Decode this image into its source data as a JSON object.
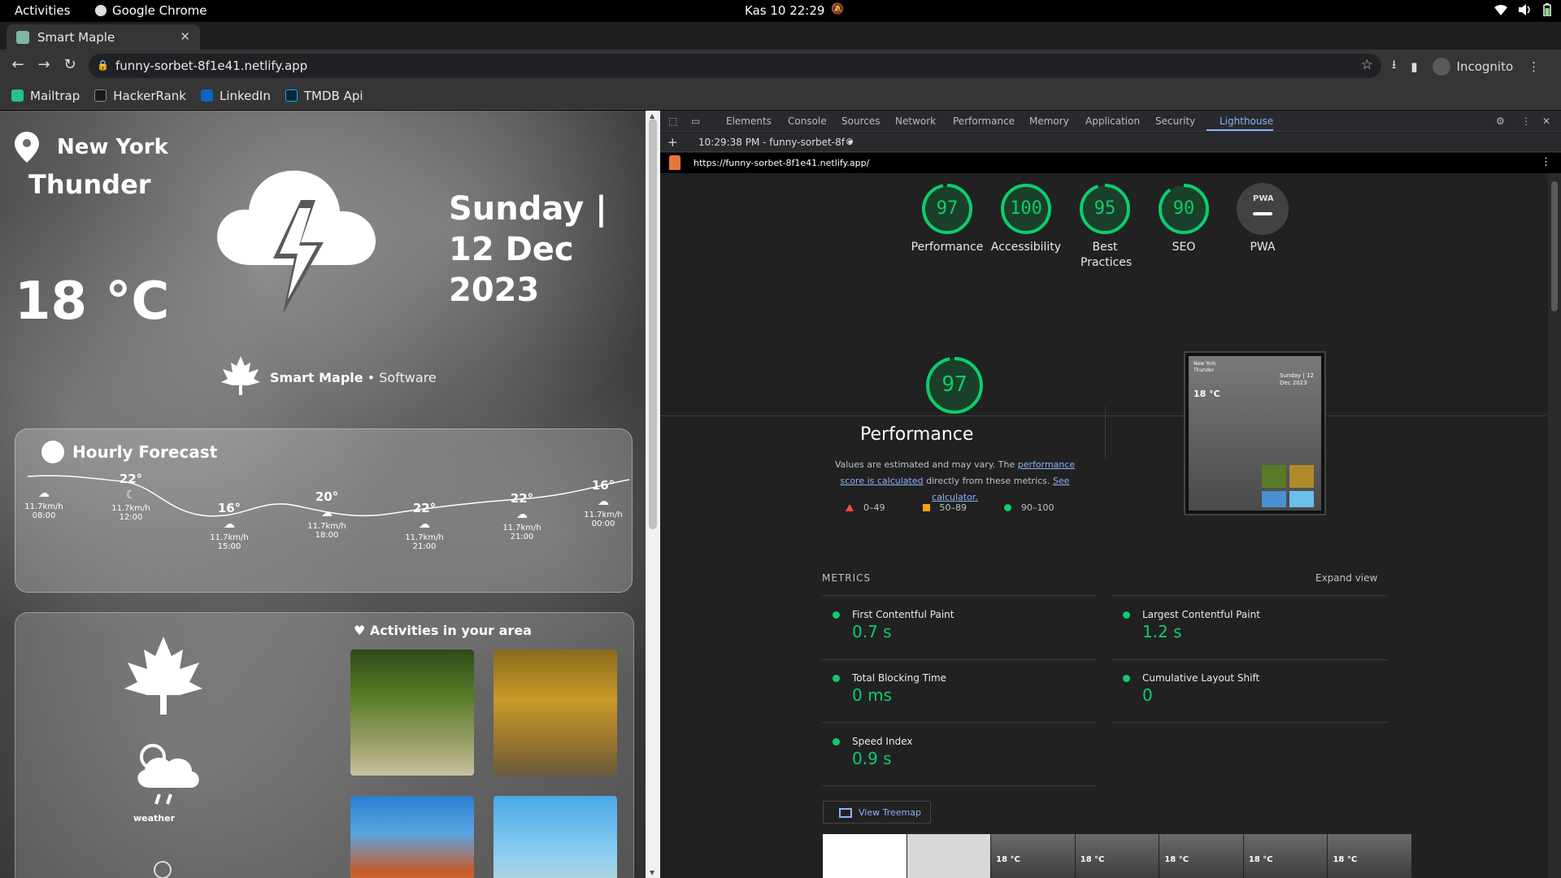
{
  "system": {
    "activities": "Activities",
    "app": "Google Chrome",
    "clock": "Kas 10  22:29"
  },
  "browser": {
    "tab_title": "Smart Maple",
    "url": "funny-sorbet-8f1e41.netlify.app",
    "incognito": "Incognito",
    "bookmarks": [
      "Mailtrap",
      "HackerRank",
      "LinkedIn",
      "TMDB Api"
    ]
  },
  "weather": {
    "city": "New York",
    "condition": "Thunder",
    "temperature": "18 °C",
    "date": "Sunday | 12 Dec 2023",
    "brand_name": "Smart Maple",
    "brand_sep": "•",
    "brand_suffix": "Software",
    "hourly_title": "Hourly Forecast",
    "hourly": [
      {
        "temp": "",
        "speed": "11.7km/h",
        "time": "08:00"
      },
      {
        "temp": "22°",
        "speed": "11.7km/h",
        "time": "12:00"
      },
      {
        "temp": "16°",
        "speed": "11.7km/h",
        "time": "15:00"
      },
      {
        "temp": "20°",
        "speed": "11.7km/h",
        "time": "18:00"
      },
      {
        "temp": "22°",
        "speed": "11.7km/h",
        "time": "21:00"
      },
      {
        "temp": "22°",
        "speed": "11.7km/h",
        "time": "21:00"
      },
      {
        "temp": "16°",
        "speed": "11.7km/h",
        "time": "00:00"
      }
    ],
    "activities_title": "Activities in your area",
    "side_label": "weather"
  },
  "devtools": {
    "tabs": [
      "Elements",
      "Console",
      "Sources",
      "Network",
      "Performance",
      "Memory",
      "Application",
      "Security",
      "Lighthouse"
    ],
    "active_tab": "Lighthouse",
    "report_select": "10:29:38 PM - funny-sorbet-8f",
    "report_url": "https://funny-sorbet-8f1e41.netlify.app/"
  },
  "lighthouse": {
    "scores": [
      {
        "label": "Performance",
        "value": "97",
        "fraction": 0.97
      },
      {
        "label": "Accessibility",
        "value": "100",
        "fraction": 1.0
      },
      {
        "label": "Best Practices",
        "value": "95",
        "fraction": 0.95
      },
      {
        "label": "SEO",
        "value": "90",
        "fraction": 0.9
      }
    ],
    "pwa_label": "PWA",
    "pwa_badge": "PWA",
    "perf_score": "97",
    "perf_title": "Performance",
    "desc_1": "Values are estimated and may vary. The ",
    "desc_link1": "performance score is calculated",
    "desc_2": " directly from these metrics. ",
    "desc_link2": "See calculator.",
    "legend": [
      "0–49",
      "50–89",
      "90–100"
    ],
    "metrics_heading": "METRICS",
    "expand": "Expand view",
    "metrics": [
      {
        "name": "First Contentful Paint",
        "value": "0.7 s"
      },
      {
        "name": "Largest Contentful Paint",
        "value": "1.2 s"
      },
      {
        "name": "Total Blocking Time",
        "value": "0 ms"
      },
      {
        "name": "Cumulative Layout Shift",
        "value": "0"
      },
      {
        "name": "Speed Index",
        "value": "0.9 s"
      }
    ],
    "treemap": "View Treemap",
    "thumb_temp": "18 °C",
    "thumb_city": "New York",
    "thumb_cond": "Thunder",
    "thumb_date": "Sunday | 12 Dec 2023"
  },
  "colors": {
    "pass": "#0cce6b",
    "average": "#ffa400",
    "fail": "#ff4e42",
    "link": "#8ab4f8"
  }
}
